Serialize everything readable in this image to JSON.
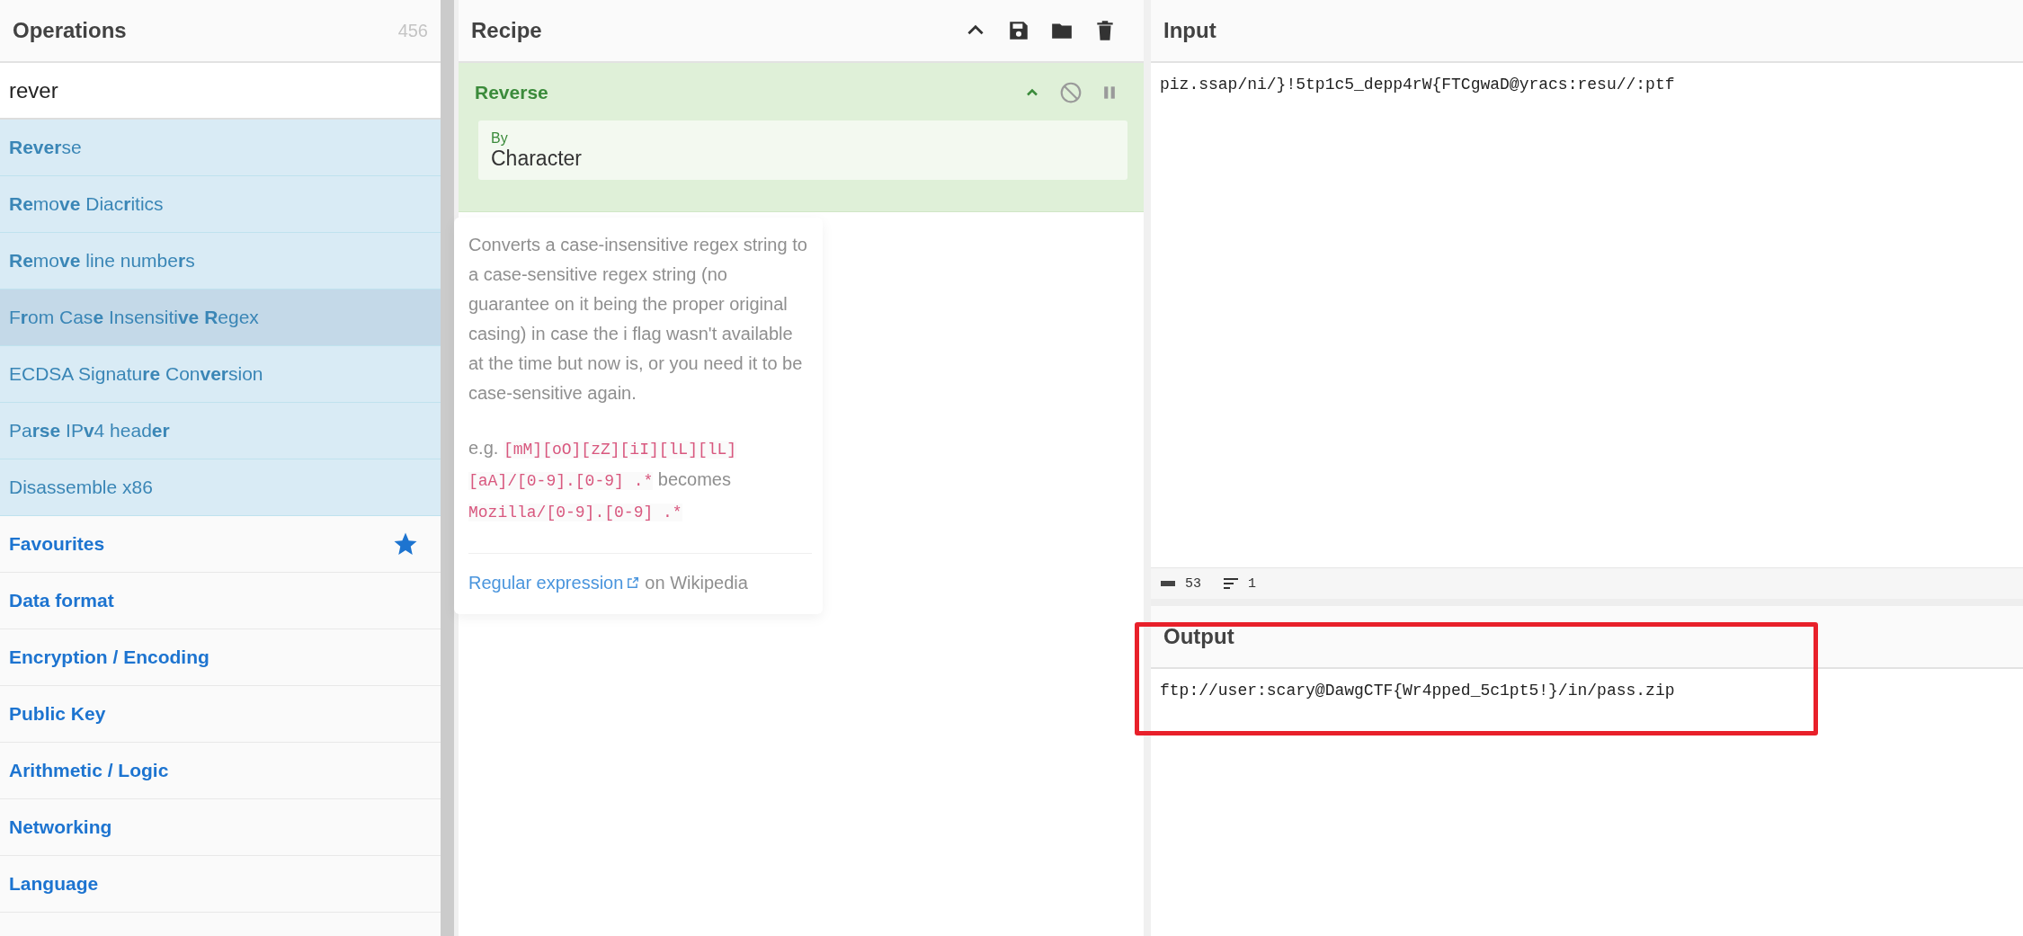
{
  "operations": {
    "title": "Operations",
    "count": "456",
    "search": {
      "value": "rever"
    },
    "results": [
      {
        "label": "**Rever**se",
        "selected": false
      },
      {
        "label": "**Re**mo**ve** Diac**r**itics",
        "selected": false
      },
      {
        "label": "**Re**mo**ve** line numbe**r**s",
        "selected": false
      },
      {
        "label": "F**r**om Cas**e** Insensiti**ve** **R**egex",
        "selected": true
      },
      {
        "label": "ECDSA Signatu**re** Con**ver**sion",
        "selected": false
      },
      {
        "label": "Pa**rse** IP**v**4 head**er**",
        "selected": false
      },
      {
        "label": "Disassemble x86",
        "selected": false
      }
    ],
    "categories": [
      {
        "label": "Favourites",
        "kind": "favourites"
      },
      {
        "label": "Data format",
        "kind": "plain"
      },
      {
        "label": "Encryption / Encoding",
        "kind": "plain"
      },
      {
        "label": "Public Key",
        "kind": "plain"
      },
      {
        "label": "Arithmetic / Logic",
        "kind": "plain"
      },
      {
        "label": "Networking",
        "kind": "plain"
      },
      {
        "label": "Language",
        "kind": "plain"
      }
    ]
  },
  "recipe": {
    "title": "Recipe",
    "operation": {
      "name": "Reverse",
      "ingredient": {
        "label": "By",
        "value": "Character"
      }
    },
    "tooltip": {
      "description": "Converts a case-insensitive regex string to a case-sensitive regex string (no guarantee on it being the proper original casing) in case the i flag wasn't available at the time but now is, or you need it to be case-sensitive again.",
      "example_prefix": "e.g.",
      "example_code": "[mM][oO][zZ][iI][lL][lL][aA]/[0-9].[0-9] .*",
      "example_middle": "becomes",
      "example_result": "Mozilla/[0-9].[0-9] .*",
      "link": "Regular expression",
      "link_suffix": "on Wikipedia"
    }
  },
  "input": {
    "title": "Input",
    "value": "piz.ssap/ni/}!5tp1c5_depp4rW{FTCgwaD@yracs:resu//:ptf",
    "length": "53",
    "lines": "1"
  },
  "output": {
    "title": "Output",
    "value": "ftp://user:scary@DawgCTF{Wr4pped_5c1pt5!}/in/pass.zip",
    "highlighted": true
  }
}
